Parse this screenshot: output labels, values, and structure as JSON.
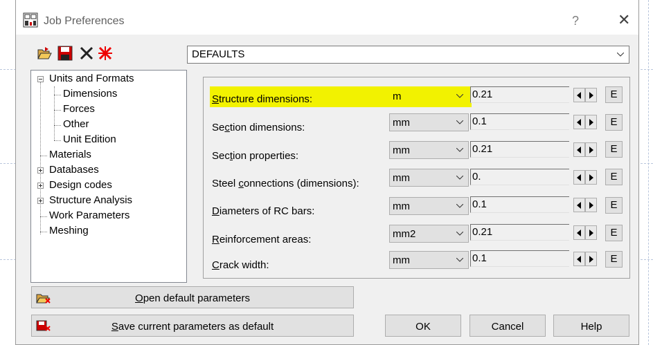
{
  "window": {
    "title": "Job Preferences",
    "help_glyph": "?",
    "close_glyph": "✕"
  },
  "toolbar": {
    "icons": [
      "open-folder-icon",
      "save-icon",
      "delete-icon",
      "reset-icon"
    ],
    "preset_value": "DEFAULTS"
  },
  "tree": {
    "items": [
      {
        "label": "Units and Formats",
        "expanded": true
      },
      {
        "label": "Dimensions",
        "selected": true
      },
      {
        "label": "Forces"
      },
      {
        "label": "Other"
      },
      {
        "label": "Unit Edition"
      },
      {
        "label": "Materials"
      },
      {
        "label": "Databases",
        "expanded": false
      },
      {
        "label": "Design codes",
        "expanded": false
      },
      {
        "label": "Structure Analysis",
        "expanded": false
      },
      {
        "label": "Work Parameters"
      },
      {
        "label": "Meshing"
      }
    ]
  },
  "dimensions": {
    "rows": [
      {
        "label_u": "S",
        "label_rest": "tructure dimensions:",
        "unit": "m",
        "value": "0.21",
        "e": "E"
      },
      {
        "label_pre": "Se",
        "label_u": "c",
        "label_rest": "tion dimensions:",
        "unit": "mm",
        "value": "0.1",
        "e": "E"
      },
      {
        "label_pre": "Sec",
        "label_u": "t",
        "label_rest": "ion properties:",
        "unit": "mm",
        "value": "0.21",
        "e": "E"
      },
      {
        "label_pre": "Steel ",
        "label_u": "c",
        "label_rest": "onnections (dimensions):",
        "unit": "mm",
        "value": "0.",
        "e": "E"
      },
      {
        "label_u": "D",
        "label_rest": "iameters of RC bars:",
        "unit": "mm",
        "value": "0.1",
        "e": "E"
      },
      {
        "label_u": "R",
        "label_rest": "einforcement areas:",
        "unit": "mm2",
        "value": "0.21",
        "e": "E"
      },
      {
        "label_u": "C",
        "label_rest": "rack width:",
        "unit": "mm",
        "value": "0.1",
        "e": "E"
      }
    ]
  },
  "buttons": {
    "open_default_u": "O",
    "open_default_rest": "pen default parameters",
    "save_current_u": "S",
    "save_current_rest": "ave current parameters as default",
    "ok": "OK",
    "cancel": "Cancel",
    "help": "Help"
  },
  "colors": {
    "highlight": "#f2f200",
    "dialog_bg": "#f0f0f0",
    "button_bg": "#e1e1e1"
  }
}
